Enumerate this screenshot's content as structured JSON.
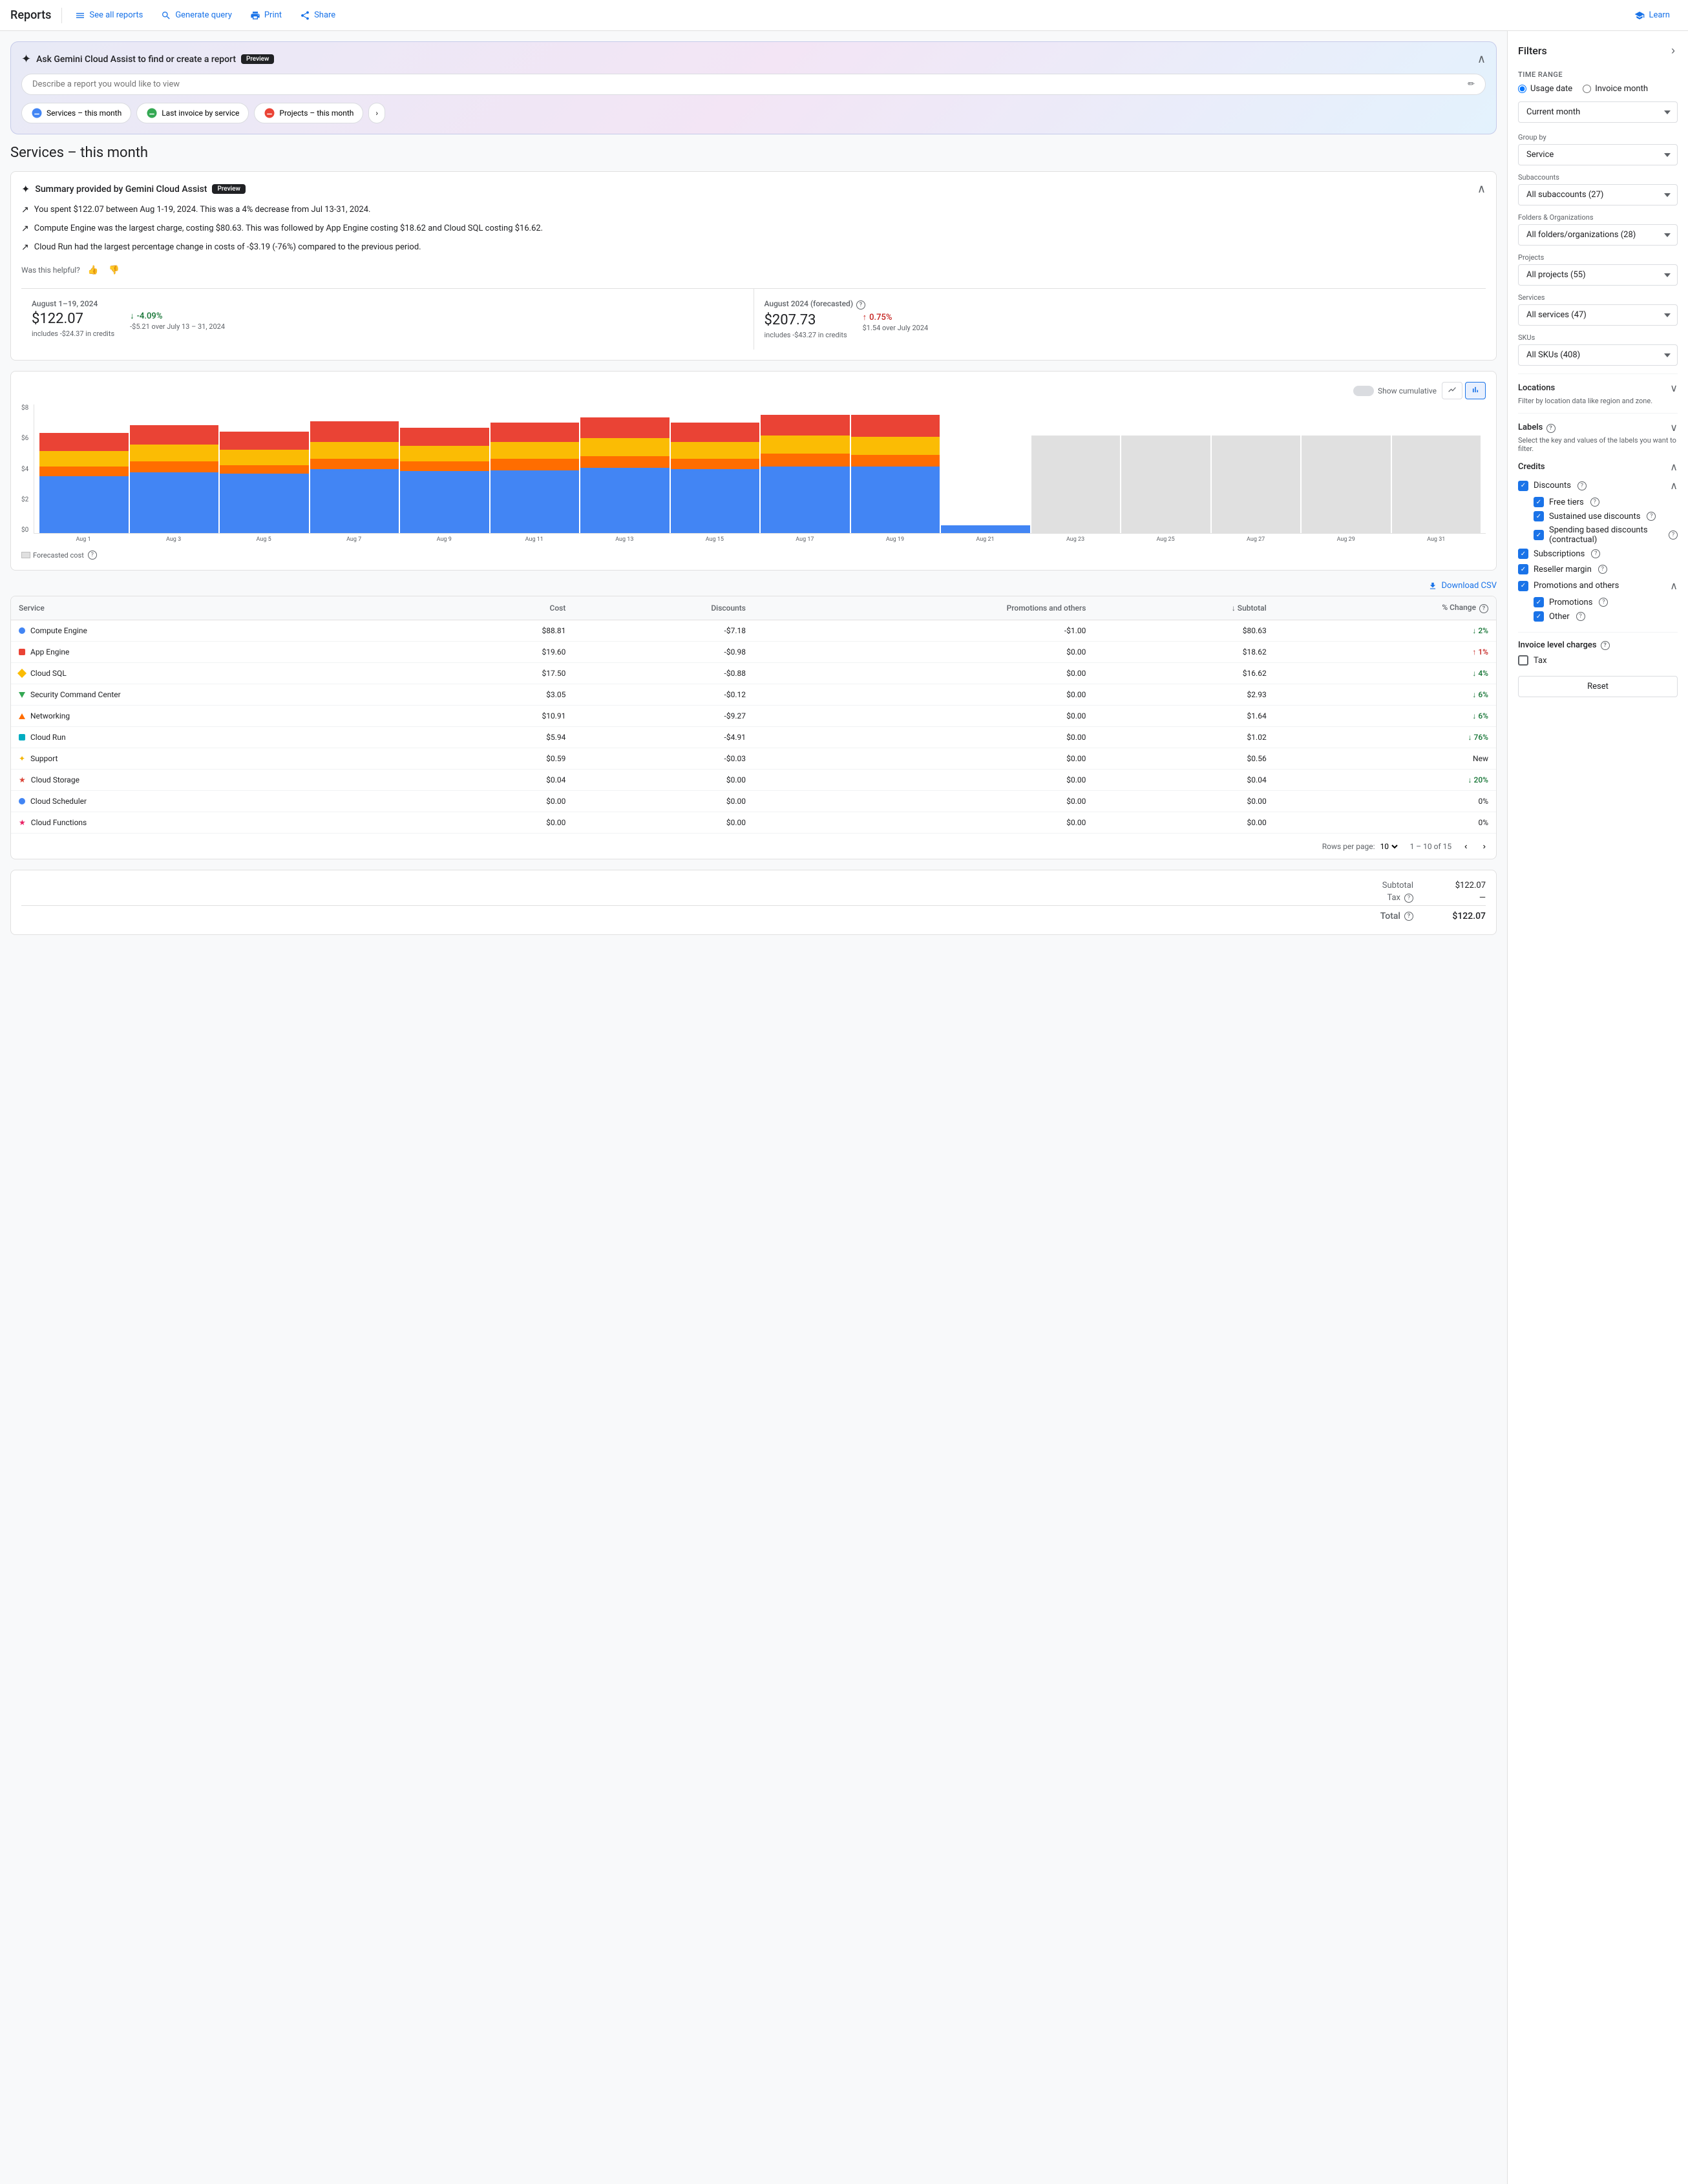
{
  "nav": {
    "title": "Reports",
    "buttons": [
      {
        "label": "See all reports",
        "icon": "list-icon"
      },
      {
        "label": "Generate query",
        "icon": "search-icon"
      },
      {
        "label": "Print",
        "icon": "print-icon"
      },
      {
        "label": "Share",
        "icon": "share-icon"
      },
      {
        "label": "Learn",
        "icon": "learn-icon"
      }
    ]
  },
  "gemini": {
    "title": "Ask Gemini Cloud Assist to find or create a report",
    "badge": "Preview",
    "placeholder": "Describe a report you would like to view",
    "quickBtns": [
      {
        "label": "Services – this month"
      },
      {
        "label": "Last invoice by service"
      },
      {
        "label": "Projects – this month"
      }
    ]
  },
  "pageTitle": "Services – this month",
  "summary": {
    "title": "Summary provided by Gemini Cloud Assist",
    "badge": "Preview",
    "lines": [
      "You spent $122.07 between Aug 1-19, 2024. This was a 4% decrease from Jul 13-31, 2024.",
      "Compute Engine was the largest charge, costing $80.63. This was followed by App Engine costing $18.62 and Cloud SQL costing $16.62.",
      "Cloud Run had the largest percentage change in costs of -$3.19 (-76%) compared to the previous period."
    ],
    "helpful_label": "Was this helpful?"
  },
  "stats": {
    "current": {
      "period": "August 1–19, 2024",
      "amount": "$122.07",
      "change": "↓ -4.09%",
      "changeType": "down",
      "sub1": "includes -$24.37 in credits",
      "sub2": "-$5.21 over July 13 – 31, 2024"
    },
    "forecasted": {
      "period": "August 2024 (forecasted)",
      "amount": "$207.73",
      "change": "↑ 0.75%",
      "changeType": "up",
      "sub1": "includes -$43.27 in credits",
      "sub2": "$1.54 over July 2024"
    }
  },
  "chart": {
    "showCumulativeLabel": "Show cumulative",
    "yLabels": [
      "$8",
      "$6",
      "$4",
      "$2",
      "$0"
    ],
    "xLabels": [
      "Aug 1",
      "Aug 3",
      "Aug 5",
      "Aug 7",
      "Aug 9",
      "Aug 11",
      "Aug 13",
      "Aug 15",
      "Aug 17",
      "Aug 19",
      "Aug 21",
      "Aug 23",
      "Aug 25",
      "Aug 27",
      "Aug 29",
      "Aug 31"
    ],
    "forecastedLabel": "Forecasted cost"
  },
  "table": {
    "downloadLabel": "Download CSV",
    "columns": [
      "Service",
      "Cost",
      "Discounts",
      "Promotions and others",
      "Subtotal",
      "% Change"
    ],
    "rows": [
      {
        "icon": "dot",
        "color": "#4285f4",
        "service": "Compute Engine",
        "cost": "$88.81",
        "discounts": "-$7.18",
        "promotions": "-$1.00",
        "subtotal": "$80.63",
        "change": "2%",
        "changeType": "down"
      },
      {
        "icon": "square",
        "color": "#ea4335",
        "service": "App Engine",
        "cost": "$19.60",
        "discounts": "-$0.98",
        "promotions": "$0.00",
        "subtotal": "$18.62",
        "change": "1%",
        "changeType": "up"
      },
      {
        "icon": "diamond",
        "color": "#fbbc04",
        "service": "Cloud SQL",
        "cost": "$17.50",
        "discounts": "-$0.88",
        "promotions": "$0.00",
        "subtotal": "$16.62",
        "change": "4%",
        "changeType": "down"
      },
      {
        "icon": "triangle-down",
        "color": "#34a853",
        "service": "Security Command Center",
        "cost": "$3.05",
        "discounts": "-$0.12",
        "promotions": "$0.00",
        "subtotal": "$2.93",
        "change": "6%",
        "changeType": "down"
      },
      {
        "icon": "triangle-up",
        "color": "#ff6d00",
        "service": "Networking",
        "cost": "$10.91",
        "discounts": "-$9.27",
        "promotions": "$0.00",
        "subtotal": "$1.64",
        "change": "6%",
        "changeType": "down"
      },
      {
        "icon": "square",
        "color": "#00acc1",
        "service": "Cloud Run",
        "cost": "$5.94",
        "discounts": "-$4.91",
        "promotions": "$0.00",
        "subtotal": "$1.02",
        "change": "76%",
        "changeType": "down"
      },
      {
        "icon": "star",
        "color": "#f4b400",
        "service": "Support",
        "cost": "$0.59",
        "discounts": "-$0.03",
        "promotions": "$0.00",
        "subtotal": "$0.56",
        "change": "New",
        "changeType": "neutral"
      },
      {
        "icon": "star2",
        "color": "#db4437",
        "service": "Cloud Storage",
        "cost": "$0.04",
        "discounts": "$0.00",
        "promotions": "$0.00",
        "subtotal": "$0.04",
        "change": "20%",
        "changeType": "down"
      },
      {
        "icon": "dot",
        "color": "#4285f4",
        "service": "Cloud Scheduler",
        "cost": "$0.00",
        "discounts": "$0.00",
        "promotions": "$0.00",
        "subtotal": "$0.00",
        "change": "0%",
        "changeType": "neutral"
      },
      {
        "icon": "star3",
        "color": "#e91e63",
        "service": "Cloud Functions",
        "cost": "$0.00",
        "discounts": "$0.00",
        "promotions": "$0.00",
        "subtotal": "$0.00",
        "change": "0%",
        "changeType": "neutral"
      }
    ],
    "pagination": {
      "rowsPerPageLabel": "Rows per page:",
      "rowsPerPage": "10",
      "pageInfo": "1 – 10 of 15"
    }
  },
  "totals": {
    "subtotalLabel": "Subtotal",
    "subtotalValue": "$122.07",
    "taxLabel": "Tax",
    "taxValue": "—",
    "totalLabel": "Total",
    "totalValue": "$122.07"
  },
  "filters": {
    "title": "Filters",
    "timeRange": {
      "label": "Time range",
      "usageDate": "Usage date",
      "invoiceMonth": "Invoice month",
      "currentMonth": "Current month"
    },
    "groupBy": {
      "label": "Group by",
      "value": "Service"
    },
    "subaccounts": {
      "label": "Subaccounts",
      "value": "All subaccounts (27)"
    },
    "foldersOrgs": {
      "label": "Folders & Organizations",
      "value": "All folders/organizations (28)"
    },
    "projects": {
      "label": "Projects",
      "value": "All projects (55)"
    },
    "services": {
      "label": "Services",
      "value": "All services (47)"
    },
    "skus": {
      "label": "SKUs",
      "value": "All SKUs (408)"
    },
    "locations": {
      "label": "Locations",
      "desc": "Filter by location data like region and zone."
    },
    "labels": {
      "label": "Labels",
      "desc": "Select the key and values of the labels you want to filter."
    },
    "credits": {
      "label": "Credits",
      "discounts": "Discounts",
      "freeTiers": "Free tiers",
      "sustainedUse": "Sustained use discounts",
      "spendingBased": "Spending based discounts (contractual)",
      "subscriptions": "Subscriptions",
      "resellerMargin": "Reseller margin",
      "promotionsAndOthers": "Promotions and others",
      "promotions": "Promotions",
      "other": "Other"
    },
    "invoiceCharges": {
      "label": "Invoice level charges",
      "tax": "Tax"
    },
    "resetBtn": "Reset"
  }
}
